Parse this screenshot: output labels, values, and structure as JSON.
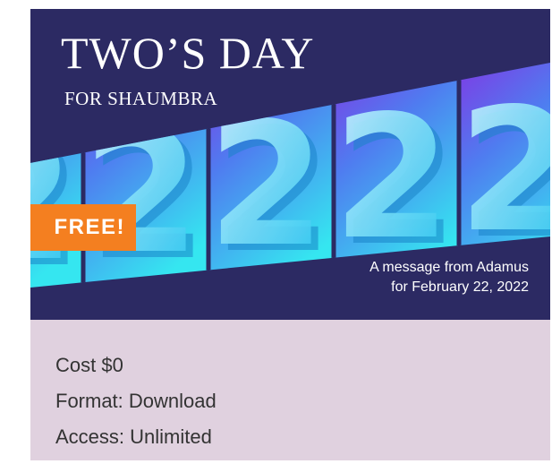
{
  "banner": {
    "title": "TWO’S DAY",
    "subtitle": "FOR SHAUMBRA",
    "badge": "FREE!",
    "message_line1": "A message from Adamus",
    "message_line2": "for February 22, 2022",
    "digit": "2",
    "colors": {
      "background": "#2c2a63",
      "badge": "#f47f20",
      "tile_purple": "#8a2be2",
      "tile_cyan": "#35e6f0"
    }
  },
  "details": {
    "cost": "Cost $0",
    "format": "Format: Download",
    "access": "Access: Unlimited",
    "background": "#e0d1df"
  }
}
